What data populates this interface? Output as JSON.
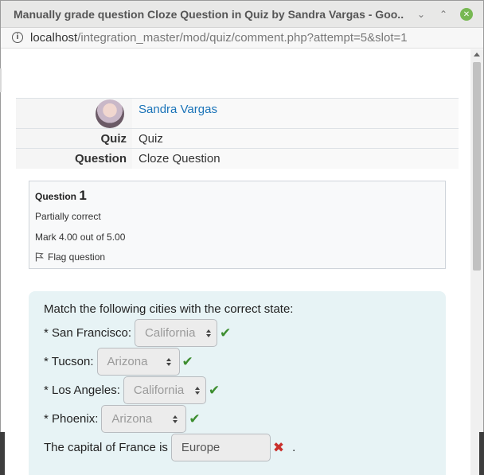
{
  "window": {
    "title": "Manually grade question Cloze Question in Quiz by Sandra Vargas - Goo...",
    "url_host": "localhost",
    "url_path": "/integration_master/mod/quiz/comment.php?attempt=5&slot=1",
    "min_glyph": "⌄",
    "max_glyph": "⌃",
    "close_glyph": "✕"
  },
  "summary": {
    "user_name": "Sandra Vargas",
    "quiz_label": "Quiz",
    "quiz_value": "Quiz",
    "question_label": "Question",
    "question_value": "Cloze Question"
  },
  "question_info": {
    "question_word": "Question",
    "number": "1",
    "state": "Partially correct",
    "grade": "Mark 4.00 out of 5.00",
    "flag_label": "Flag question"
  },
  "formulation": {
    "prompt": "Match the following cities with the correct state:",
    "rows": [
      {
        "label": "* San Francisco:",
        "selected": "California",
        "result": "correct"
      },
      {
        "label": "* Tucson:",
        "selected": "Arizona",
        "result": "correct"
      },
      {
        "label": "* Los Angeles:",
        "selected": "California",
        "result": "correct"
      },
      {
        "label": "* Phoenix:",
        "selected": "Arizona",
        "result": "correct"
      }
    ],
    "capital_label": "The capital of France is",
    "capital_answer": "Europe",
    "capital_suffix": ".",
    "correct_glyph": "✔",
    "incorrect_glyph": "✖"
  },
  "colors": {
    "link": "#1a73b8",
    "correct": "#3c8d2f",
    "incorrect": "#c9302c",
    "formulation_bg": "#e7f3f5"
  }
}
